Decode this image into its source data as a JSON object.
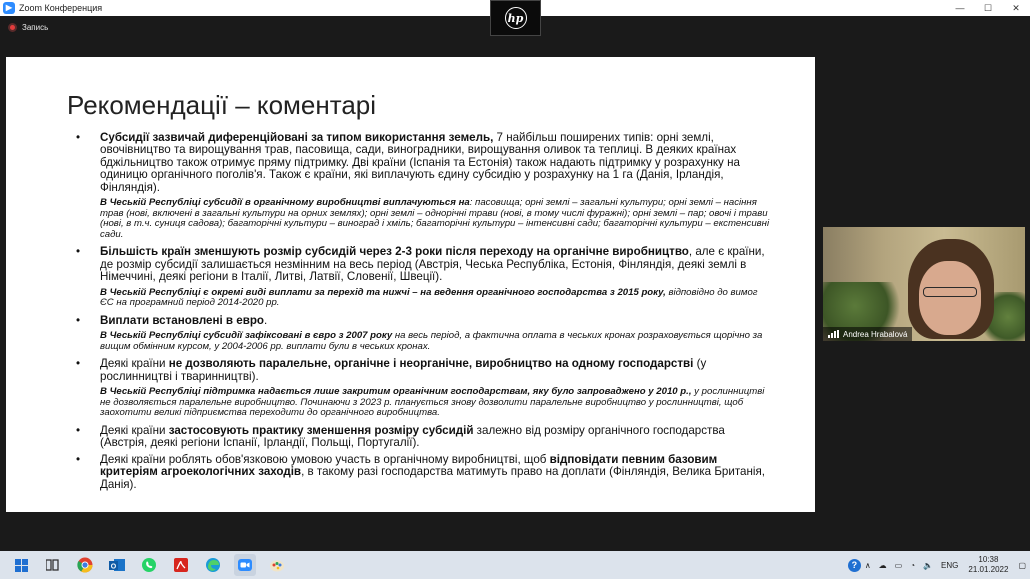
{
  "window": {
    "title": "Zoom Конференция",
    "recording_label": "Запись",
    "controls": [
      "—",
      "☐",
      "✕"
    ]
  },
  "presenter_thumb": {
    "logo_text": "hp"
  },
  "slide": {
    "title": "Рекомендації – коментарі",
    "bullets": [
      {
        "bold": "Субсидії зазвичай  диференційовані за типом використання земель,",
        "text": " 7 найбільш поширених типів: орні землі, овочівництво та вирощування трав, пасовища, сади, виноградники, вирощування оливок та теплиці. В деяких країнах бджільництво також отримує пряму підтримку. Дві країни (Іспанія та Естонія) також надають підтримку у розрахунку на одиницю органічного поголів'я. Також є країни, які виплачують єдину субсидію у розрахунку на 1 га (Данія, Ірландія, Фінляндія).",
        "sub_bold": "В Чеській Республіці субсидії в органічному виробництві виплачуються на",
        "sub_text": ": пасовища; орні землі – загальні культури; орні землі – насіння трав (нові, включені в загальні культури на орних землях); орні землі – однорічні трави (нові, в тому числі фуражні); орні землі – пар; овочі і трави (нові, в т.ч. суниця садова); багаторічні культури – виноград і хміль; багаторічні культури – інтенсивні сади; багаторічні культури – екстенсивні сади."
      },
      {
        "bold": "Більшість країн зменшують розмір субсидій через 2-3 роки після переходу на органічне виробництво",
        "text": ", але є країни, де розмір субсидії залишається незмінним на весь період (Австрія, Чеська Республіка, Естонія, Фінляндія, деякі землі в Німеччині, деякі регіони в Італії, Литві, Латвії, Словенії, Швеції).",
        "sub_bold": "В Чеській Республіці є окремі виді виплати за перехід та нижчі – на ведення органічного господарства з 2015 року,",
        "sub_text": " відповідно до вимог ЄС на програмний період 2014-2020 рр."
      },
      {
        "bold": "Виплати встановлені в евро",
        "text": ".",
        "sub_bold": "В Чеській Республіці субсидії зафіксовані в євро з 2007 року",
        "sub_text": " на весь період, а фактична оплата в чеських кронах розраховується щорічно за вищим обмінним курсом, у 2004-2006 рр. виплати були в чеських кронах."
      },
      {
        "pre": "Деякі країни ",
        "bold": "не дозволяють паралельне, органічне і неорганічне, виробництво на одному господарстві",
        "text": " (у рослинництві і тваринництві).",
        "sub_bold": "В Чеській Республіці підтримка надається лише закритим органічним господарствам, яку було запроваджено у 2010 р.,",
        "sub_text": " у рослинництві не дозволяється паралельне виробництво. Починаючи з 2023 р. планується знову дозволити паралельне виробництво у рослинництві, щоб заохотити великі підприємства переходити до органічного виробництва."
      },
      {
        "pre": "Деякі країни ",
        "bold": "застосовують практику зменшення розміру субсидій",
        "text": " залежно від розміру органічного господарства (Австрія, деякі регіони Іспанії, Ірландії, Польщі, Португалії)."
      },
      {
        "pre": "Деякі країни роблять обов'язковою умовою участь в органічному виробництві, щоб ",
        "bold": "відповідати певним базовим критеріям агроекологічних заходів",
        "text": ", в такому разі господарства матимуть право на доплати (Фінляндія, Велика Британія, Данія)."
      }
    ]
  },
  "video": {
    "participant_name": "Andrea Hrabalová"
  },
  "taskbar": {
    "language": "ENG",
    "time": "10:38",
    "date": "21.01.2022",
    "help_label": "?"
  },
  "colors": {
    "zoom_blue": "#2d8cff",
    "record_red": "#e23c3c",
    "taskbar_bg": "#dce3ec"
  }
}
